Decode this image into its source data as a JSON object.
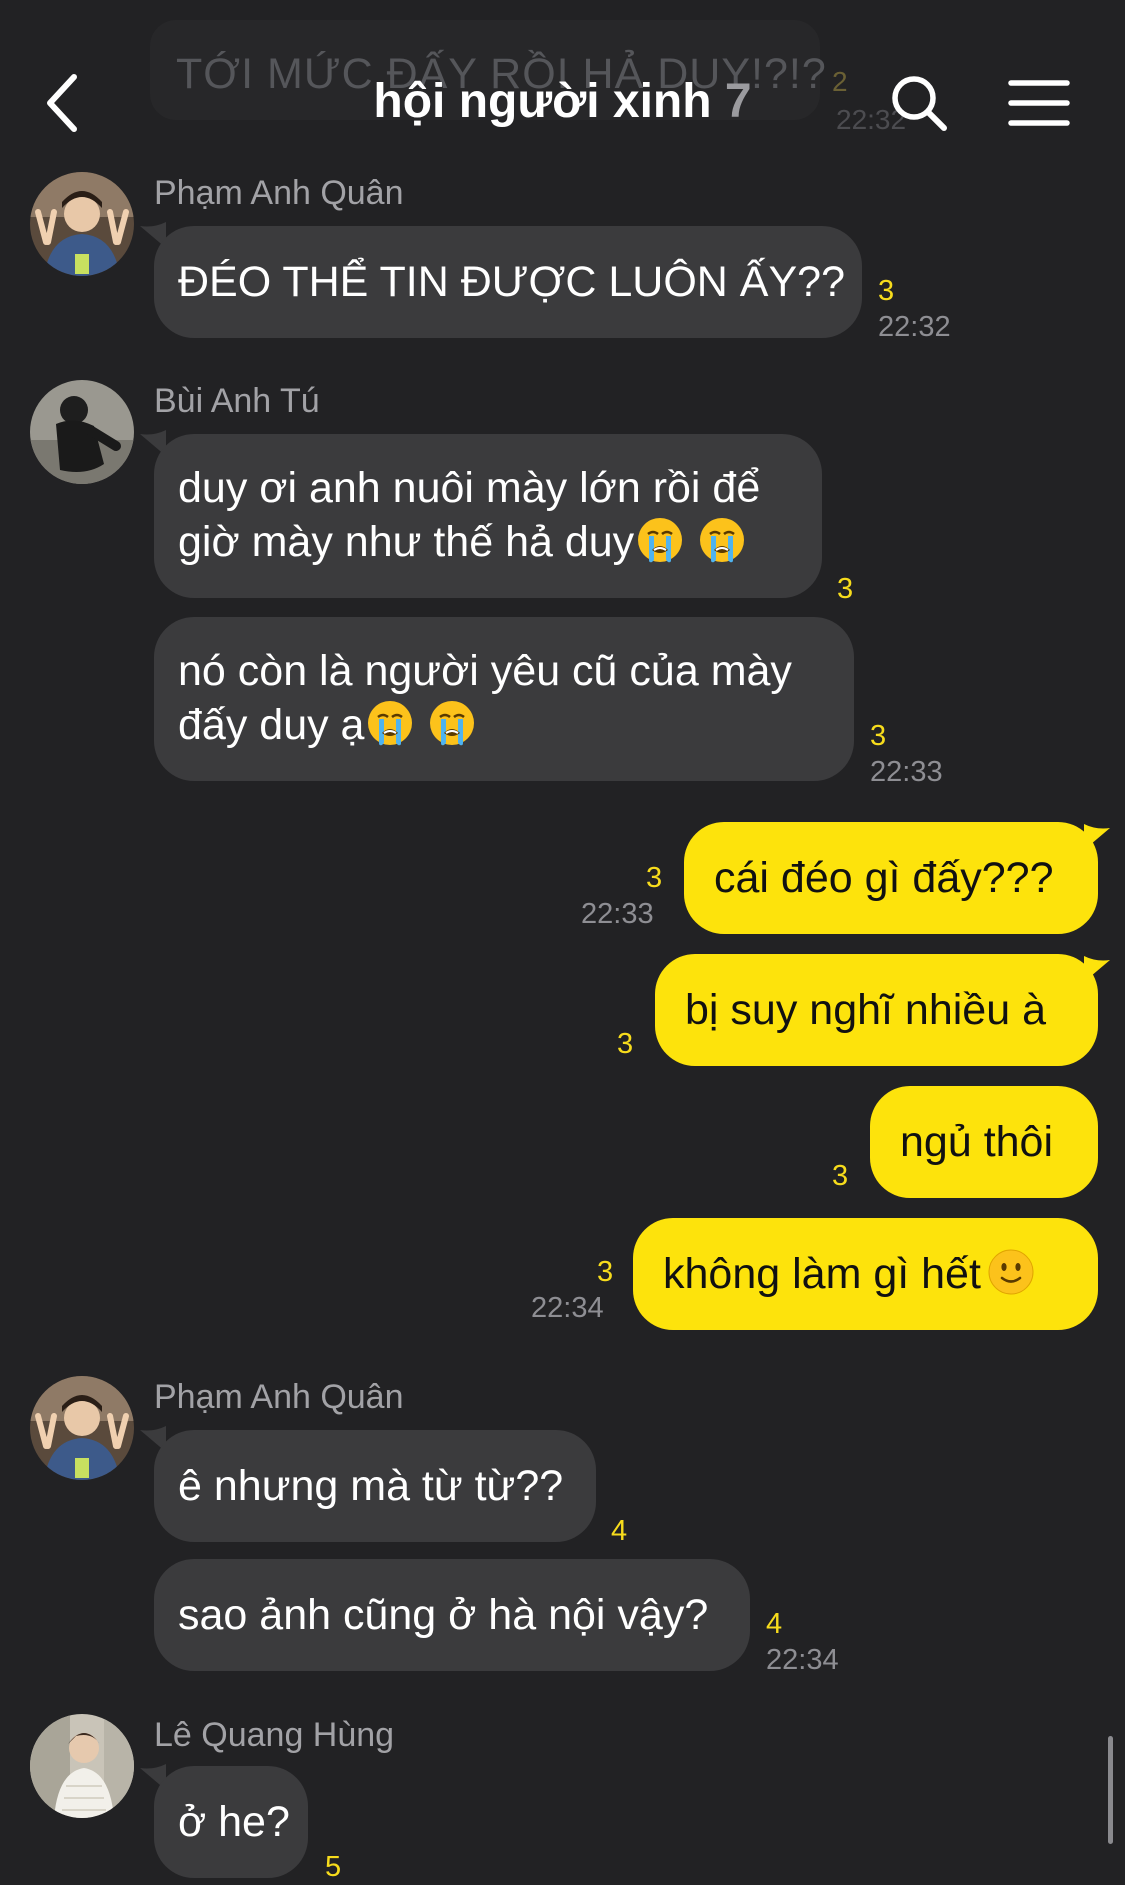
{
  "header": {
    "title": "hội người xinh",
    "member_count": "7",
    "back_icon": "chevron-left-icon",
    "search_icon": "search-icon",
    "menu_icon": "hamburger-menu-icon"
  },
  "ghost": {
    "text": "TỚI MỨC ĐẤY RỒI HẢ DUY!?!?",
    "count": "2",
    "time": "22:32"
  },
  "senders": {
    "s1": "Phạm Anh Quân",
    "s2": "Bùi Anh Tú",
    "s3": "Phạm Anh Quân",
    "s4": "Lê Quang Hùng"
  },
  "messages": {
    "m1": {
      "line1": "ĐÉO THỂ TIN ĐƯỢC LUÔN ẤY??",
      "count": "3",
      "time": "22:32"
    },
    "m2": {
      "line1": "duy ơi anh nuôi mày lớn rồi để",
      "line2": "giờ mày như thế hả duy",
      "count": "3"
    },
    "m3": {
      "line1": "nó còn là người yêu cũ của mày",
      "line2": "đấy duy ạ",
      "count": "3",
      "time": "22:33"
    },
    "m4": {
      "line1": "cái đéo gì đấy???",
      "count": "3",
      "time": "22:33"
    },
    "m5": {
      "line1": "bị suy nghĩ nhiều à",
      "count": "3"
    },
    "m6": {
      "line1": "ngủ thôi",
      "count": "3"
    },
    "m7": {
      "line1": "không làm gì hết",
      "count": "3",
      "time": "22:34"
    },
    "m8": {
      "line1": "ê nhưng mà từ từ??",
      "count": "4"
    },
    "m9": {
      "line1": "sao ảnh cũng ở hà nội vậy?",
      "count": "4",
      "time": "22:34"
    },
    "m10": {
      "line1": "ở he?",
      "count": "5"
    }
  },
  "colors": {
    "background": "#222224",
    "incoming_bubble": "#3b3b3d",
    "outgoing_bubble": "#fde30c",
    "read_count": "#f7dc1c",
    "timestamp": "#8e8e93"
  }
}
